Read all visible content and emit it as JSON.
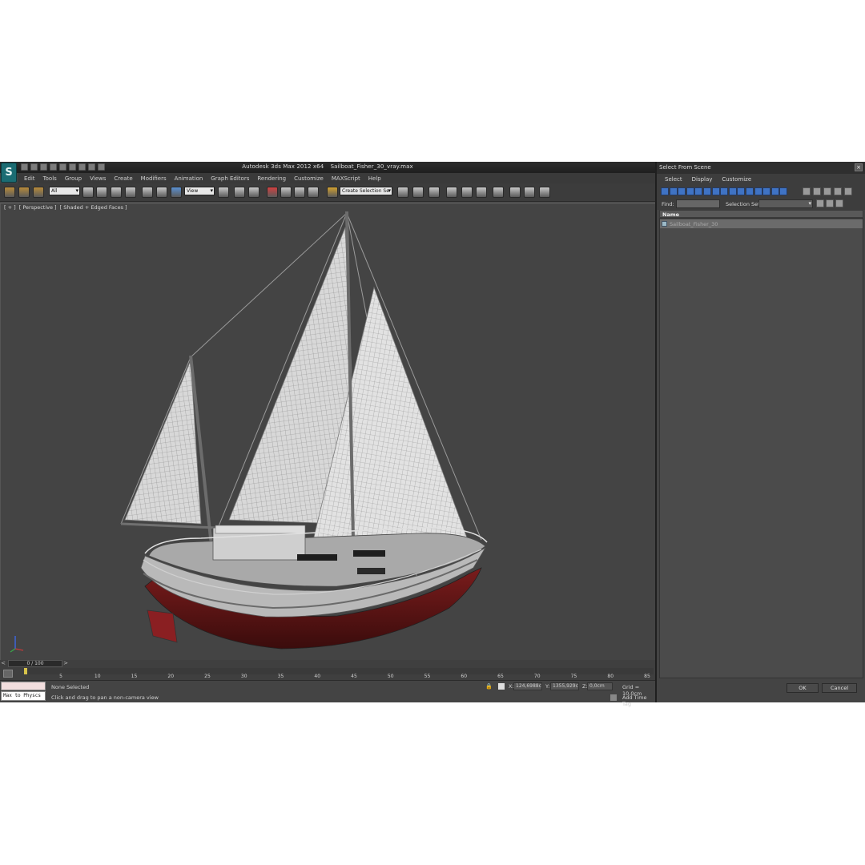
{
  "app": {
    "product_title": "Autodesk 3ds Max  2012 x64",
    "file_name": "Sailboat_Fisher_30_vray.max",
    "logo_glyph": "S",
    "menus": [
      "Edit",
      "Tools",
      "Group",
      "Views",
      "Create",
      "Modifiers",
      "Animation",
      "Graph Editors",
      "Rendering",
      "Customize",
      "MAXScript",
      "Help"
    ]
  },
  "toolbar": {
    "selection_filter": "All",
    "reference_coord": "View",
    "named_selection_set": "Create Selection Se"
  },
  "viewport": {
    "label_parts": [
      "[ + ]",
      "[ Perspective ]",
      "[ Shaded + Edged Faces ]"
    ]
  },
  "timeline": {
    "slider_text": "0 / 100",
    "prev_glyph": "<",
    "next_glyph": ">",
    "ticks": [
      "5",
      "10",
      "15",
      "20",
      "25",
      "30",
      "35",
      "40",
      "45",
      "50",
      "55",
      "60",
      "65",
      "70",
      "75",
      "80",
      "85"
    ]
  },
  "status": {
    "maxscript_input": "Max to Physcs",
    "selection_text": "None Selected",
    "prompt_text": "Click and drag to pan a non-camera view",
    "x_label": "X:",
    "x_value": "124,6988c",
    "y_label": "Y:",
    "y_value": "1355,929c",
    "z_label": "Z:",
    "z_value": "0,0cm",
    "grid_text": "Grid = 10,0cm",
    "add_time_tag": "Add Time Tag",
    "lock_glyph": "🔒"
  },
  "dialog": {
    "title": "Select From Scene",
    "close_glyph": "×",
    "menus": [
      "Select",
      "Display",
      "Customize"
    ],
    "find_label": "Find:",
    "selection_set_label": "Selection Set:",
    "column_name": "Name",
    "objects": [
      "Sailboat_Fisher_30"
    ],
    "ok_label": "OK",
    "cancel_label": "Cancel"
  }
}
